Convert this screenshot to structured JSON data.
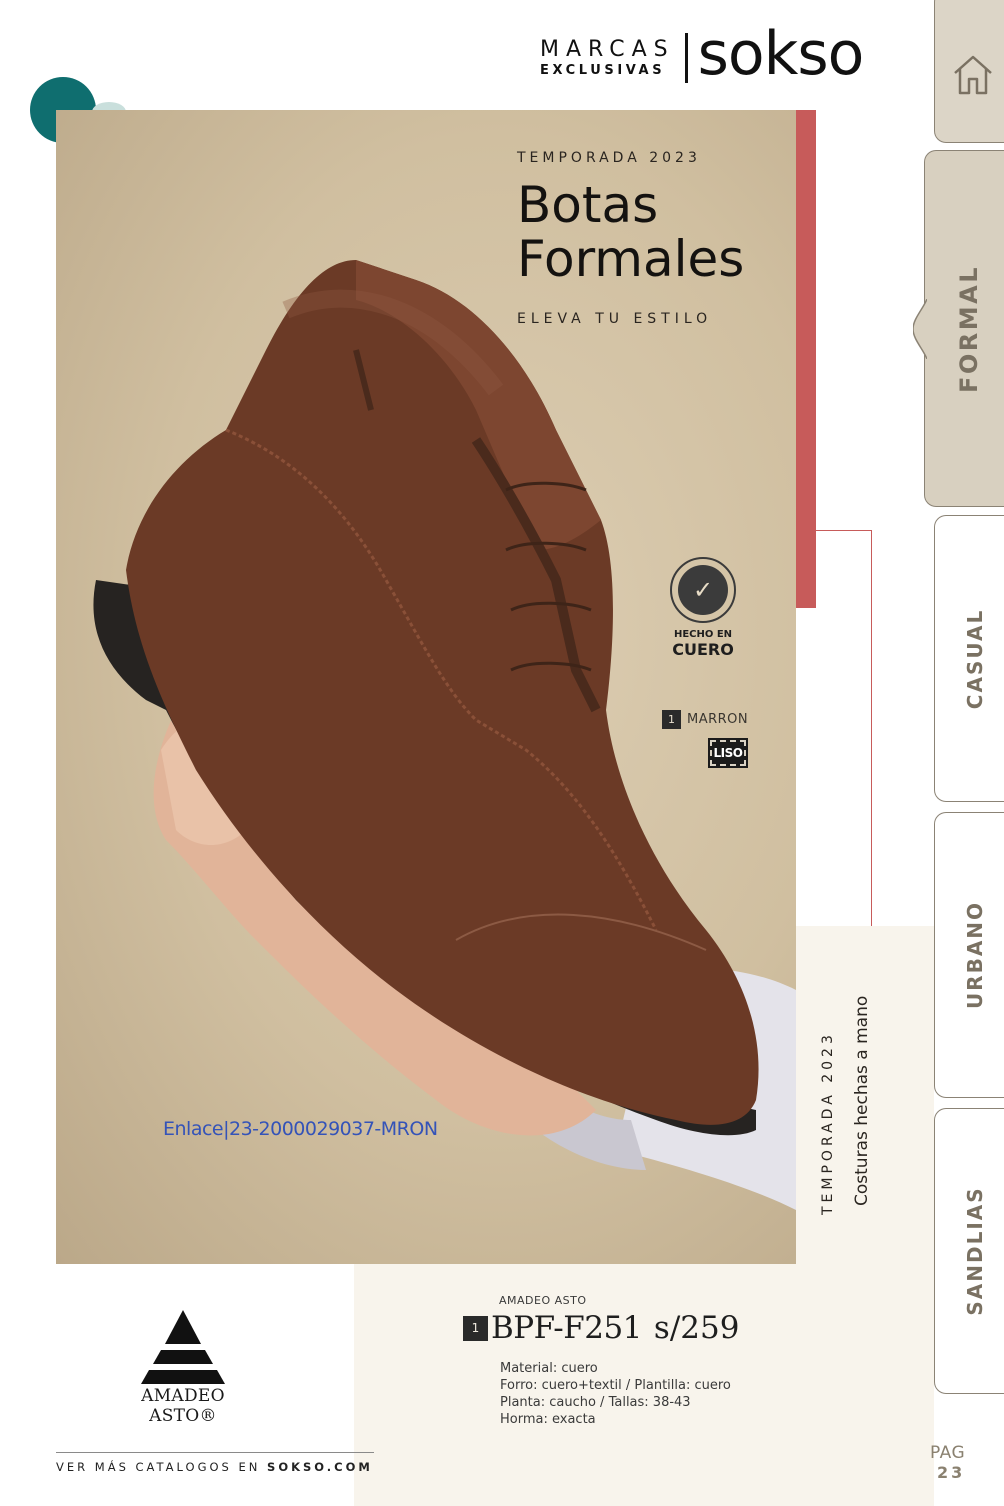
{
  "header": {
    "brand_line1": "MARCAS",
    "brand_line2": "EXCLUSIVAS",
    "brand_logo": "sokso"
  },
  "hero": {
    "season": "TEMPORADA 2023",
    "title_line1": "Botas",
    "title_line2": "Formales",
    "subtitle": "ELEVA TU ESTILO",
    "badge_line1": "HECHO EN",
    "badge_line2": "CUERO",
    "badge_icon": "leather-check-icon",
    "color_number": "1",
    "color_name": "MARRON",
    "finish_tag": "LISO",
    "link_code": "Enlace|23-2000029037-MRON"
  },
  "side_vertical": {
    "season": "TEMPORADA 2023",
    "tagline": "Costuras hechas a mano"
  },
  "product": {
    "brand_name": "AMADEO ASTO",
    "brand_logo_text": "AMADEO ASTO®",
    "number": "1",
    "code": "BPF-F251",
    "price": "s/259",
    "specs": [
      "Material: cuero",
      "Forro: cuero+textil / Plantilla: cuero",
      "Planta: caucho / Tallas: 38-43",
      "Horma: exacta"
    ]
  },
  "footer": {
    "text_prefix": "VER MÁS CATALOGOS EN ",
    "text_site": "SOKSO.COM",
    "page_label": "PAG",
    "page_number": "23"
  },
  "tabs": {
    "home_icon": "home-icon",
    "items": [
      "FORMAL",
      "CASUAL",
      "URBANO",
      "SANDLIAS"
    ],
    "active": "FORMAL"
  },
  "colors": {
    "accent_red": "#c75b5a",
    "teal": "#0f6e6f",
    "cream": "#f8f4ec",
    "tab_text": "#7a7162",
    "link_blue": "#3453b8"
  }
}
